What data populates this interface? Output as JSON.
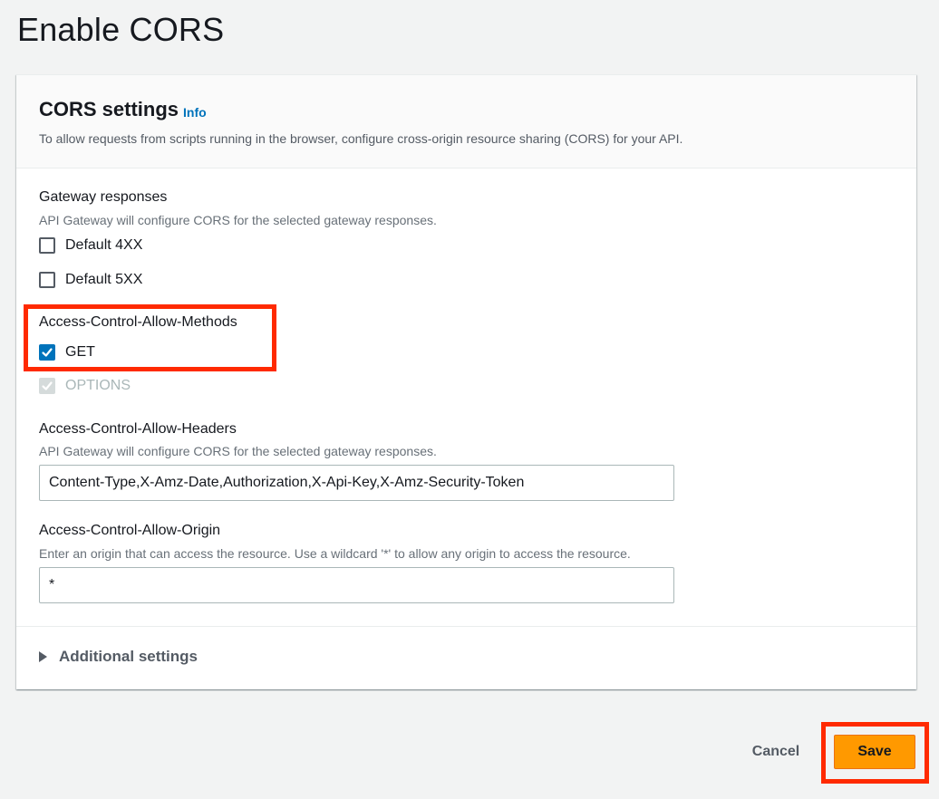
{
  "page": {
    "title": "Enable CORS"
  },
  "panel": {
    "title": "CORS settings",
    "info_label": "Info",
    "description": "To allow requests from scripts running in the browser, configure cross-origin resource sharing (CORS) for your API."
  },
  "gateway_responses": {
    "label": "Gateway responses",
    "description": "API Gateway will configure CORS for the selected gateway responses.",
    "options": [
      {
        "label": "Default 4XX",
        "checked": false
      },
      {
        "label": "Default 5XX",
        "checked": false
      }
    ]
  },
  "allow_methods": {
    "label": "Access-Control-Allow-Methods",
    "options": [
      {
        "label": "GET",
        "checked": true,
        "disabled": false
      },
      {
        "label": "OPTIONS",
        "checked": true,
        "disabled": true
      }
    ]
  },
  "allow_headers": {
    "label": "Access-Control-Allow-Headers",
    "description": "API Gateway will configure CORS for the selected gateway responses.",
    "value": "Content-Type,X-Amz-Date,Authorization,X-Api-Key,X-Amz-Security-Token"
  },
  "allow_origin": {
    "label": "Access-Control-Allow-Origin",
    "description": "Enter an origin that can access the resource. Use a wildcard '*' to allow any origin to access the resource.",
    "value": "*"
  },
  "additional_settings": {
    "label": "Additional settings",
    "expanded": false
  },
  "actions": {
    "cancel_label": "Cancel",
    "save_label": "Save"
  },
  "colors": {
    "accent": "#0073bb",
    "primary_button": "#ff9900",
    "highlight": "#ff2a00"
  }
}
